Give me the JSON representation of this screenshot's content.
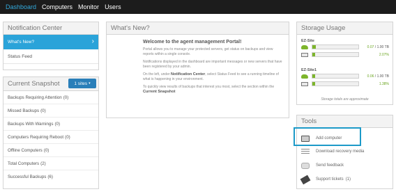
{
  "nav": {
    "items": [
      "Dashboard",
      "Computers",
      "Monitor",
      "Users"
    ],
    "active": "Dashboard"
  },
  "notification_center": {
    "title": "Notification Center",
    "items": [
      {
        "label": "What's New?",
        "selected": true
      },
      {
        "label": "Status Feed",
        "selected": false
      }
    ]
  },
  "current_snapshot": {
    "title": "Current Snapshot",
    "sites_button": "1 sites",
    "rows": [
      {
        "label": "Backups Requiring Attention",
        "count": "(0)"
      },
      {
        "label": "Missed Backups",
        "count": "(0)"
      },
      {
        "label": "Backups With Warnings",
        "count": "(0)"
      },
      {
        "label": "Computers Requiring Reboot",
        "count": "(0)"
      },
      {
        "label": "Offline Computers",
        "count": "(0)"
      },
      {
        "label": "Total Computers",
        "count": "(2)"
      },
      {
        "label": "Successful Backups",
        "count": "(6)"
      }
    ]
  },
  "whats_new": {
    "title": "What's New?",
    "heading": "Welcome to the agent management Portal!",
    "p1": "Portal allows you to manage your protected servers, get status on backups and view reports within a single console.",
    "p2": "Notifications displayed in the dashboard are important messages or new servers that have been registered by your admin.",
    "p3a": "On the left, under",
    "p3b": "Notification Center",
    "p3c": ", select Status Feed to see a running timeline of what is happening in your environment.",
    "p4a": "To quickly view results of backups that interest you most, select the section within the",
    "p4b": "Current Snapshot"
  },
  "storage": {
    "title": "Storage Usage",
    "sites": [
      {
        "name": "EZ-Site",
        "cloud_used": "0.07",
        "cloud_total": "/ 1.00 TB",
        "local_percent": "2.07%",
        "cloud_fraction": 0.07,
        "local_fraction": 0.0207
      },
      {
        "name": "EZ-Site1",
        "cloud_used": "0.06",
        "cloud_total": "/ 1.00 TB",
        "local_percent": "1.38%",
        "cloud_fraction": 0.06,
        "local_fraction": 0.0138
      }
    ],
    "note": "Storage totals are approximate"
  },
  "tools": {
    "title": "Tools",
    "items": [
      {
        "label": "Add computer",
        "icon": "laptop-icon"
      },
      {
        "label": "Download recovery media",
        "icon": "recovery-media-icon"
      },
      {
        "label": "Send feedback",
        "icon": "feedback-icon"
      },
      {
        "label": "Support tickets",
        "count": "(1)",
        "icon": "ticket-icon"
      }
    ]
  },
  "colors": {
    "accent": "#2aa3d9",
    "nav_bg": "#1c1c1c",
    "storage_green": "#7db52b",
    "highlight": "#1c9ac8"
  }
}
